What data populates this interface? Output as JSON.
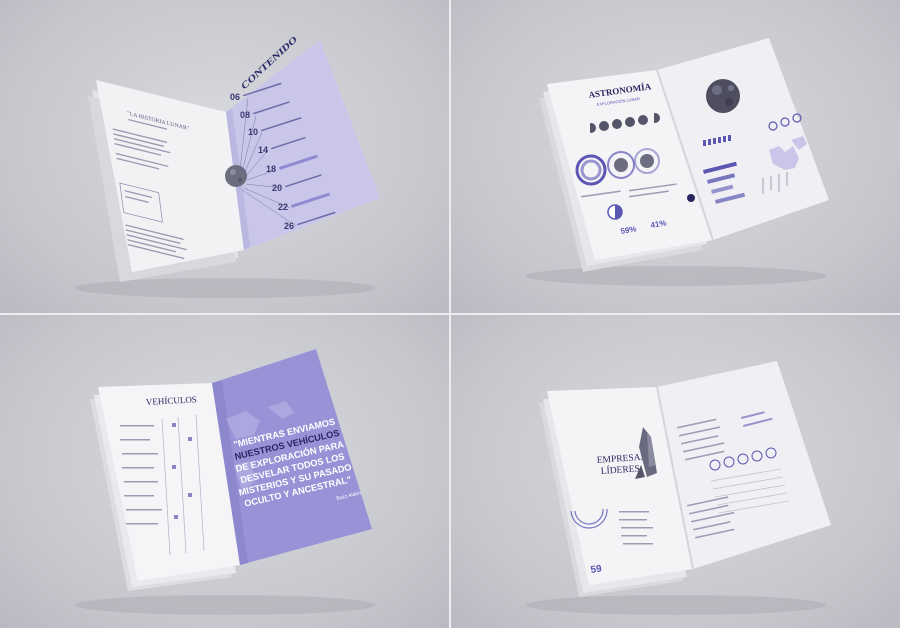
{
  "q1": {
    "contents_title": "CONTENIDO",
    "left_heading": "\"LA HISTORIA LUNAR\"",
    "pages": [
      "06",
      "08",
      "10",
      "14",
      "18",
      "20",
      "22",
      "26"
    ],
    "highlight_color": "#8f8ad1"
  },
  "q2": {
    "title": "ASTRONOMÍA",
    "subtitle": "EXPLORACIÓN LUNAR",
    "stat_a": "59%",
    "stat_b": "41%",
    "accent": "#5b57b3"
  },
  "q3": {
    "title": "VEHÍCULOS",
    "quote": "\"MIENTRAS ENVIAMOS NUESTROS VEHÍCULOS DE EXPLORACIÓN PARA DESVELAR TODOS LOS MISTERIOS Y SU PASADO OCULTO Y ANCESTRAL\"",
    "quote_lines": [
      "\"MIENTRAS ENVIAMOS",
      "NUESTROS VEHÍCULOS",
      "DE EXPLORACIÓN PARA",
      "DESVELAR TODOS LOS",
      "MISTERIOS Y SU PASADO",
      "OCULTO Y ANCESTRAL\""
    ],
    "author": "Buzz Aldrin",
    "page_color": "#9893d6"
  },
  "q4": {
    "title_line1": "EMPRESAS",
    "title_line2": "LÍDERES",
    "stat": "59"
  }
}
